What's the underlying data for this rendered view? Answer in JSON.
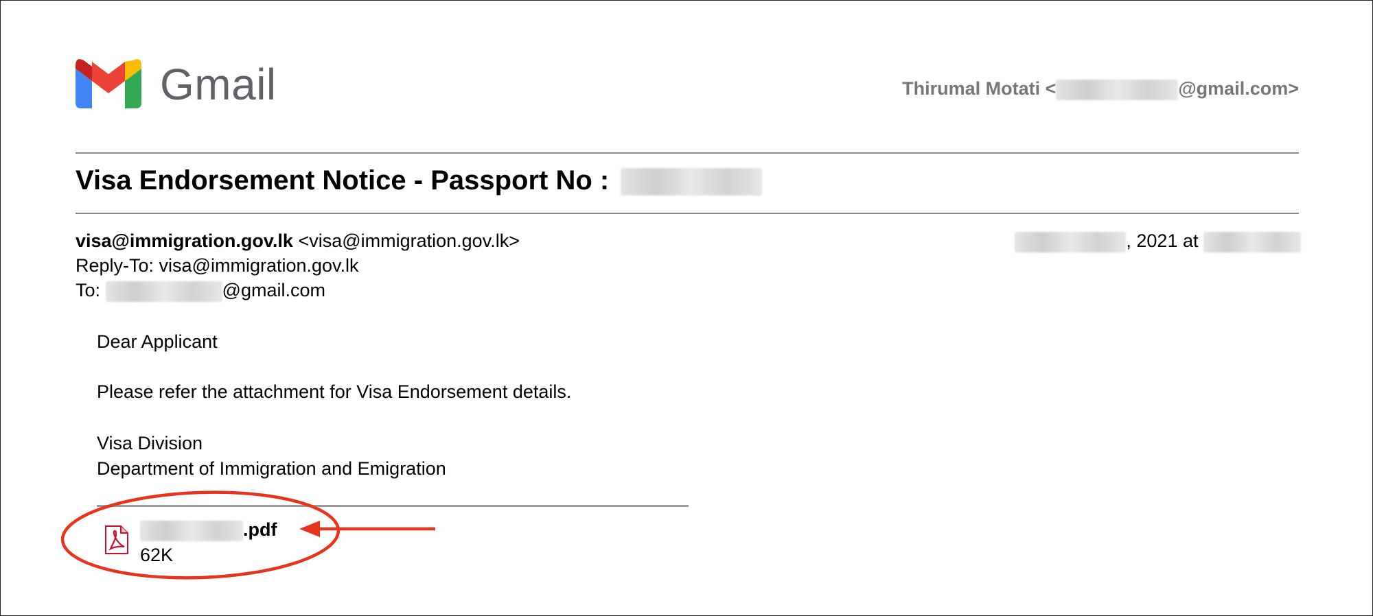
{
  "app": {
    "name": "Gmail"
  },
  "account": {
    "name": "Thirumal Motati <",
    "email_domain": "@gmail.com>"
  },
  "email": {
    "subject": "Visa Endorsement Notice - Passport No :",
    "from_name": "visa@immigration.gov.lk",
    "from_address": "<visa@immigration.gov.lk>",
    "date_mid": ", 2021 at",
    "reply_to": "Reply-To: visa@immigration.gov.lk",
    "to_label": "To:",
    "to_domain": "@gmail.com",
    "body": {
      "greeting": "Dear Applicant",
      "message": "Please refer the attachment for Visa Endorsement details.",
      "signature_line1": "Visa Division",
      "signature_line2": "Department of Immigration and Emigration"
    },
    "attachment": {
      "extension": ".pdf",
      "size": "62K"
    }
  },
  "colors": {
    "annotation": "#e8341c",
    "gmail_red": "#ea4335",
    "gmail_blue": "#4285f4",
    "gmail_green": "#34a853",
    "gmail_yellow": "#fbbc04"
  },
  "icons": [
    "gmail-logo-icon",
    "pdf-file-icon"
  ]
}
